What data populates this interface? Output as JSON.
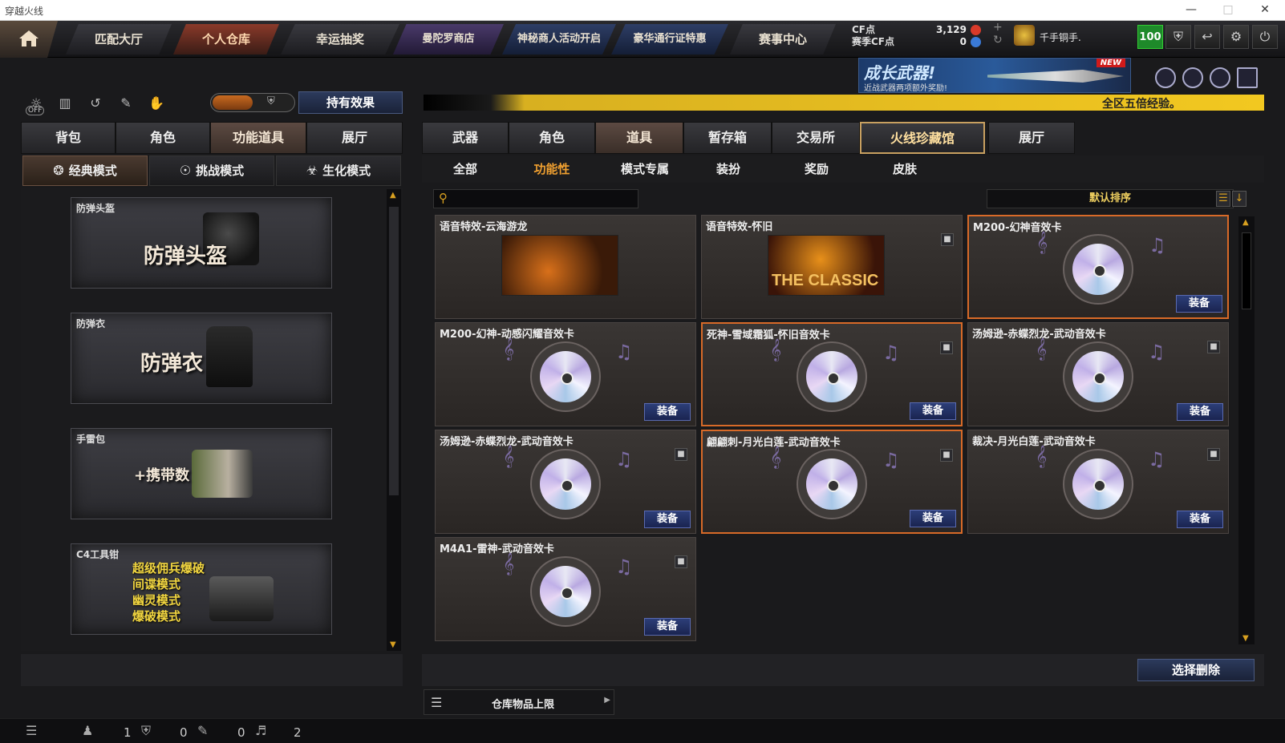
{
  "window": {
    "title": "穿越火线"
  },
  "nav": {
    "tabs": [
      "匹配大厅",
      "个人仓库",
      "幸运抽奖",
      "曼陀罗商店",
      "神秘商人活动开启",
      "豪华通行证特惠",
      "赛事中心"
    ],
    "cf_label": "CF点",
    "cf_value": "3,129",
    "season_label": "赛季CF点",
    "season_value": "0",
    "username": "千手铜手.",
    "level": "100"
  },
  "banner": {
    "title": "成长武器!",
    "subtitle": "近战武器两项额外奖励!",
    "badge": "NEW"
  },
  "left": {
    "off_label": "OFF",
    "hold_effect": "持有效果",
    "tabs": [
      "背包",
      "角色",
      "功能道具",
      "展厅"
    ],
    "modes": [
      "经典模式",
      "挑战模式",
      "生化模式"
    ],
    "cards": [
      {
        "label": "防弹头盔",
        "big": "防弹头盔"
      },
      {
        "label": "防弹衣",
        "big": "防弹衣"
      },
      {
        "label": "手雷包",
        "big": "+携带数"
      },
      {
        "label": "C4工具钳",
        "lines": [
          "超级佣兵爆破",
          "间谍模式",
          "幽灵模式",
          "爆破模式"
        ]
      }
    ]
  },
  "right": {
    "notice": "全区五倍经验。",
    "tabs": [
      "武器",
      "角色",
      "道具",
      "暂存箱",
      "交易所",
      "火线珍藏馆",
      "展厅"
    ],
    "subtabs": [
      "全部",
      "功能性",
      "模式专属",
      "装扮",
      "奖励",
      "皮肤"
    ],
    "sort_label": "默认排序",
    "equip_label": "装备",
    "items": [
      {
        "name": "语音特效-云海游龙"
      },
      {
        "name": "语音特效-怀旧",
        "art_text": "THE CLASSIC"
      },
      {
        "name": "M200-幻神音效卡"
      },
      {
        "name": "M200-幻神-动感闪耀音效卡"
      },
      {
        "name": "死神-雪域霜狐-怀旧音效卡"
      },
      {
        "name": "汤姆逊-赤蝶烈龙-武动音效卡"
      },
      {
        "name": "汤姆逊-赤蝶烈龙-武动音效卡"
      },
      {
        "name": "翩翩刺-月光白莲-武动音效卡"
      },
      {
        "name": "裁决-月光白莲-武动音效卡"
      },
      {
        "name": "M4A1-雷神-武动音效卡"
      }
    ],
    "delete_button": "选择删除",
    "capacity_label": "仓库物品上限"
  },
  "status": {
    "friends": "1",
    "guild": "0",
    "chat": "0",
    "volume": "2"
  }
}
